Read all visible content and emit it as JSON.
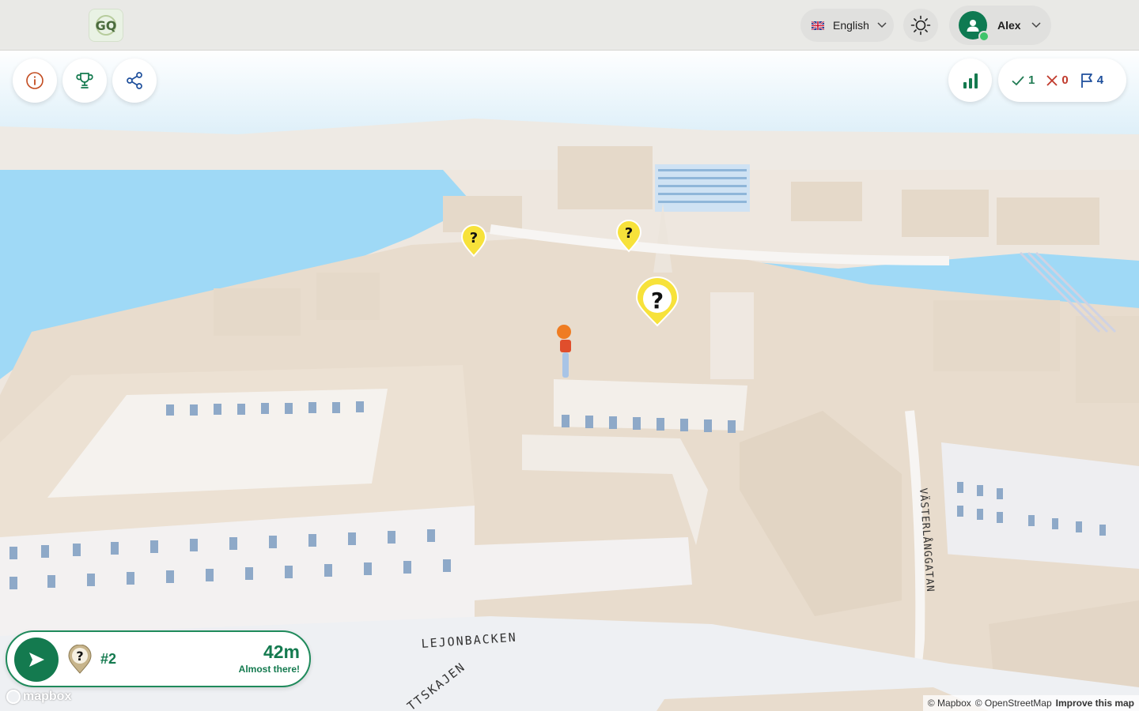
{
  "header": {
    "logo_text": "GQ",
    "language": {
      "selected": "English"
    },
    "user": {
      "name": "Alex"
    }
  },
  "toolbar": {
    "info_icon": "info-icon",
    "trophy_icon": "trophy-icon",
    "share_icon": "share-icon",
    "stats_icon": "bar-chart-icon"
  },
  "score": {
    "correct": "1",
    "wrong": "0",
    "flags": "4"
  },
  "map": {
    "street_labels": [
      "LEJONBACKEN",
      "TTSKAJEN",
      "VÄSTERLÅNGGATAN"
    ],
    "marker_icon": "question-mark-pin-icon"
  },
  "status_card": {
    "question_number": "#2",
    "distance": "42m",
    "message": "Almost there!"
  },
  "attribution": {
    "mapbox_logo": "mapbox",
    "mapbox": "© Mapbox",
    "osm": "© OpenStreetMap",
    "improve": "Improve this map"
  },
  "colors": {
    "brand_green": "#147a4f",
    "water": "#9ed9f5",
    "building": "#e8dccd",
    "marker_yellow": "#f7e23a"
  }
}
